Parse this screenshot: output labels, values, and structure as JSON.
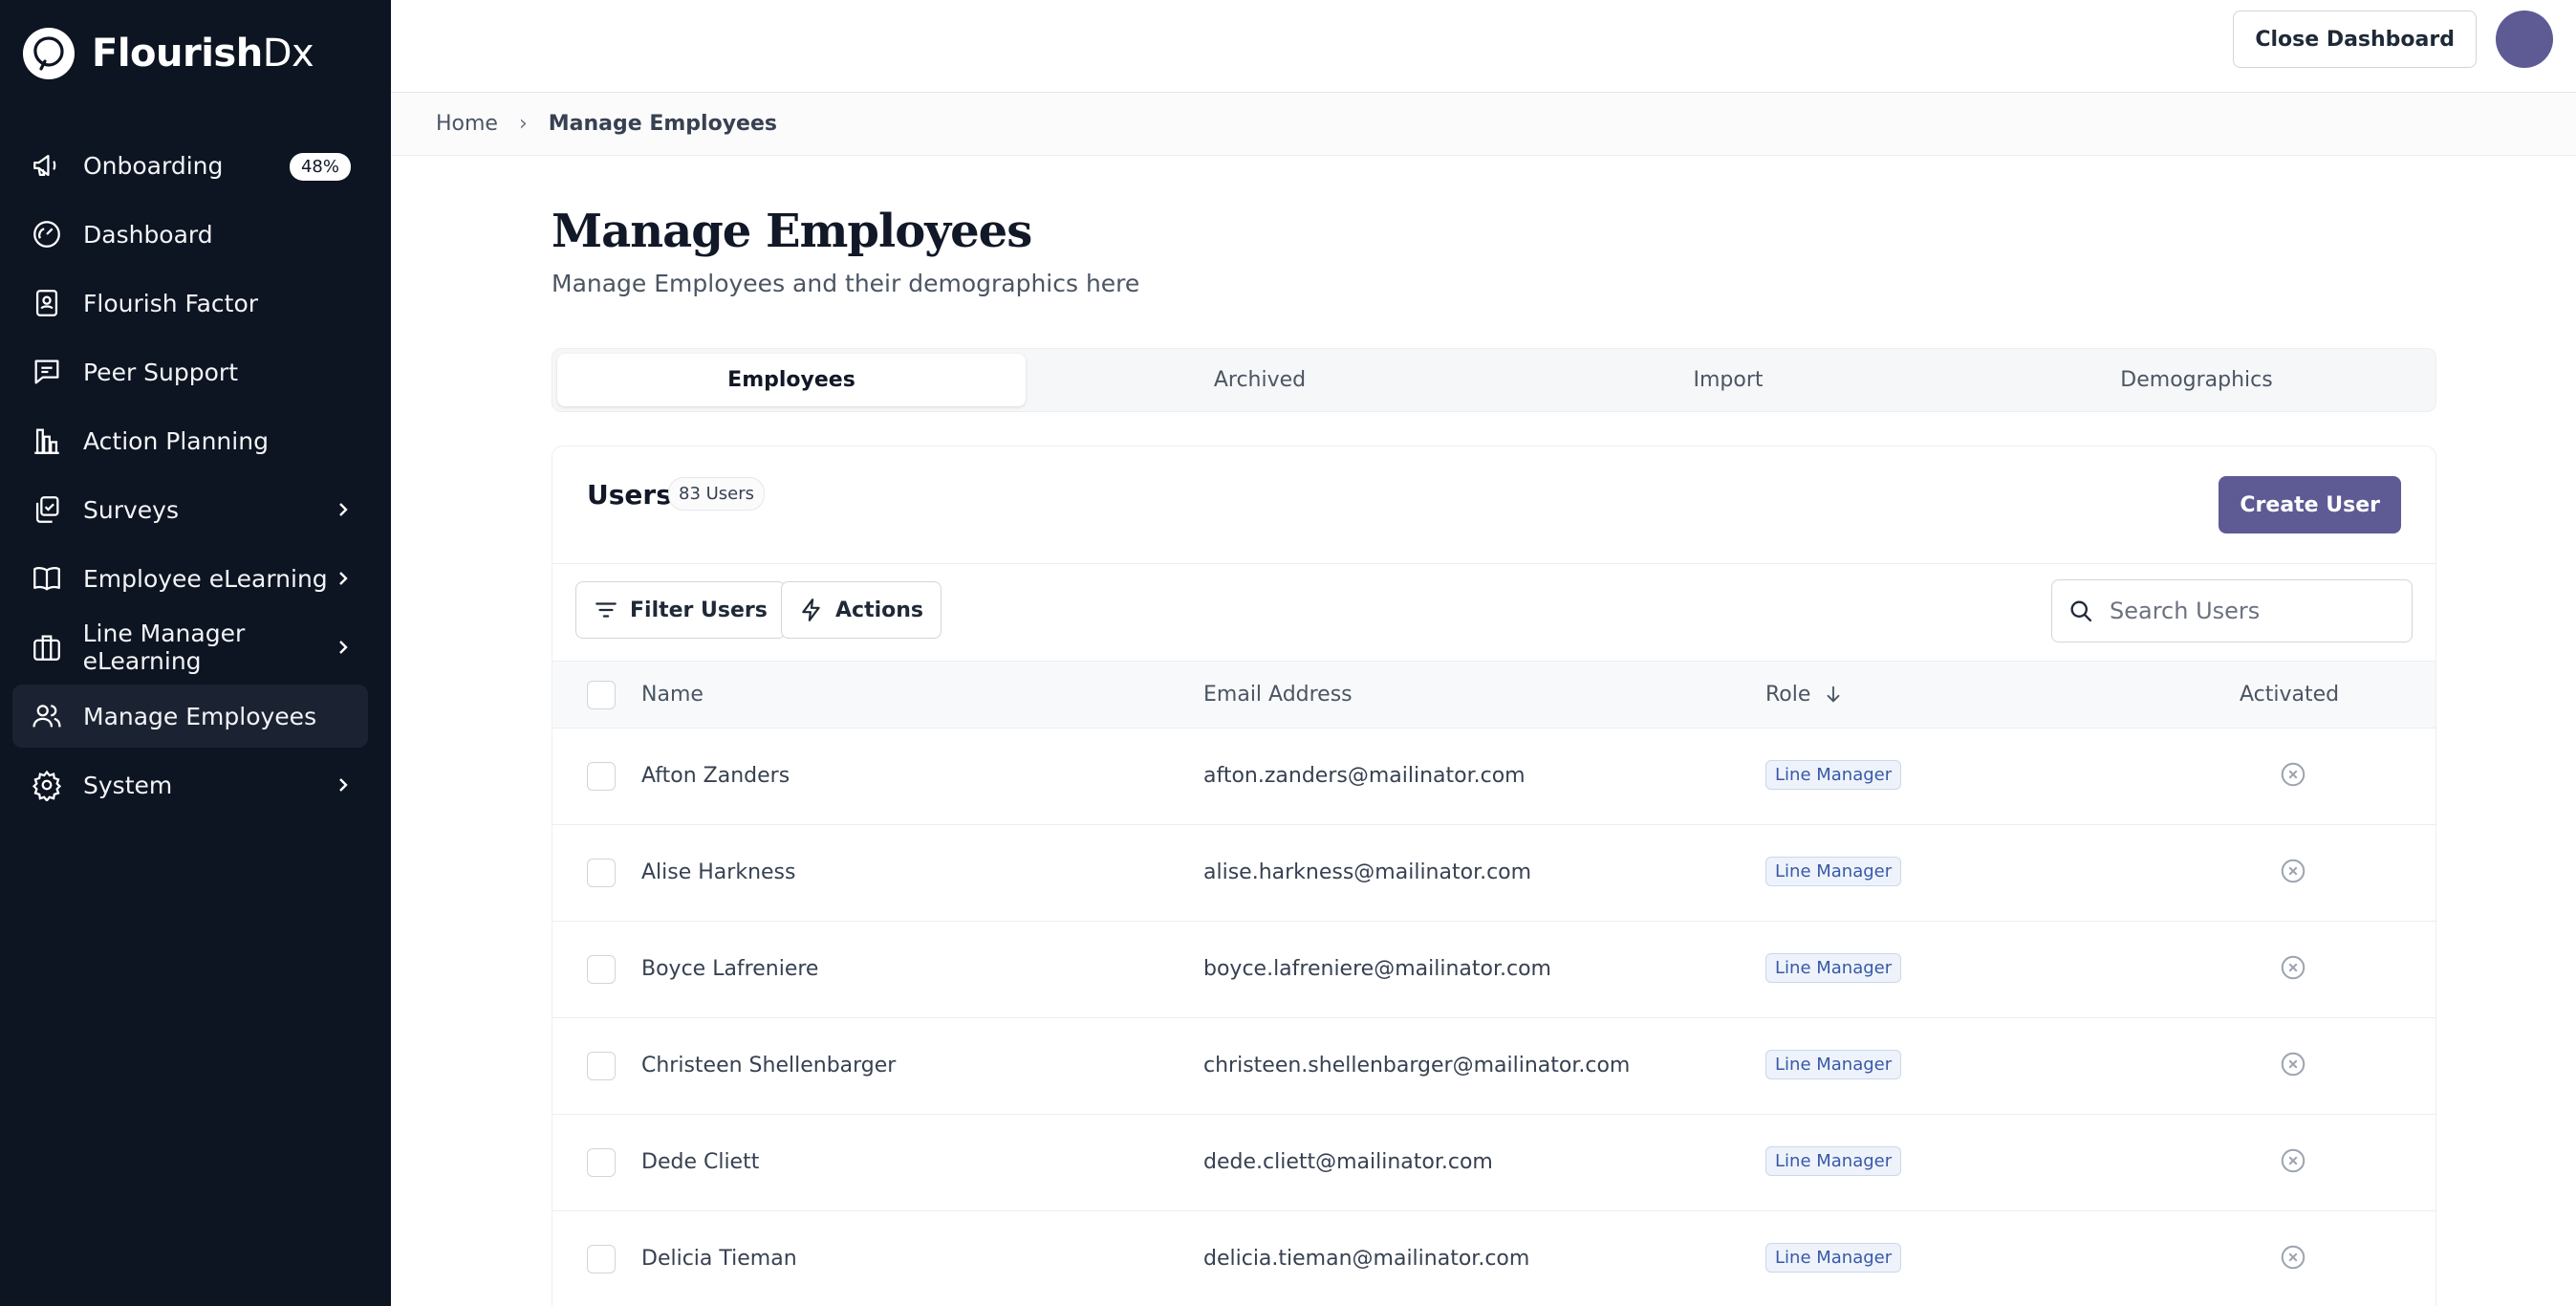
{
  "brand": {
    "name_bold": "Flourish",
    "name_light": "Dx"
  },
  "sidebar": {
    "items": [
      {
        "label": "Onboarding",
        "icon": "megaphone-icon",
        "badge": "48%"
      },
      {
        "label": "Dashboard",
        "icon": "gauge-icon"
      },
      {
        "label": "Flourish Factor",
        "icon": "report-icon"
      },
      {
        "label": "Peer Support",
        "icon": "chat-icon"
      },
      {
        "label": "Action Planning",
        "icon": "bar-chart-icon"
      },
      {
        "label": "Surveys",
        "icon": "survey-icon",
        "has_children": true
      },
      {
        "label": "Employee eLearning",
        "icon": "book-icon",
        "has_children": true
      },
      {
        "label": "Line Manager eLearning",
        "icon": "briefcase-icon",
        "has_children": true
      },
      {
        "label": "Manage Employees",
        "icon": "users-icon",
        "active": true
      },
      {
        "label": "System",
        "icon": "gear-icon",
        "has_children": true
      }
    ]
  },
  "topbar": {
    "close_label": "Close Dashboard"
  },
  "breadcrumb": {
    "home": "Home",
    "separator": "›",
    "current": "Manage Employees"
  },
  "page": {
    "title": "Manage Employees",
    "subtitle": "Manage Employees and their demographics here"
  },
  "tabs": [
    {
      "label": "Employees",
      "active": true
    },
    {
      "label": "Archived"
    },
    {
      "label": "Import"
    },
    {
      "label": "Demographics"
    }
  ],
  "users_card": {
    "title": "Users",
    "count": "83 Users",
    "create_label": "Create User",
    "filter_label": "Filter Users",
    "actions_label": "Actions",
    "search_placeholder": "Search Users",
    "columns": {
      "name": "Name",
      "email": "Email Address",
      "role": "Role",
      "activated": "Activated"
    },
    "rows": [
      {
        "name": "Afton Zanders",
        "email": "afton.zanders@mailinator.com",
        "role": "Line Manager"
      },
      {
        "name": "Alise Harkness",
        "email": "alise.harkness@mailinator.com",
        "role": "Line Manager"
      },
      {
        "name": "Boyce Lafreniere",
        "email": "boyce.lafreniere@mailinator.com",
        "role": "Line Manager"
      },
      {
        "name": "Christeen Shellenbarger",
        "email": "christeen.shellenbarger@mailinator.com",
        "role": "Line Manager"
      },
      {
        "name": "Dede Cliett",
        "email": "dede.cliett@mailinator.com",
        "role": "Line Manager"
      },
      {
        "name": "Delicia Tieman",
        "email": "delicia.tieman@mailinator.com",
        "role": "Line Manager"
      }
    ]
  },
  "colors": {
    "sidebar_bg": "#0d1422",
    "accent": "#5e5a94",
    "role_badge": "#3858a8"
  }
}
